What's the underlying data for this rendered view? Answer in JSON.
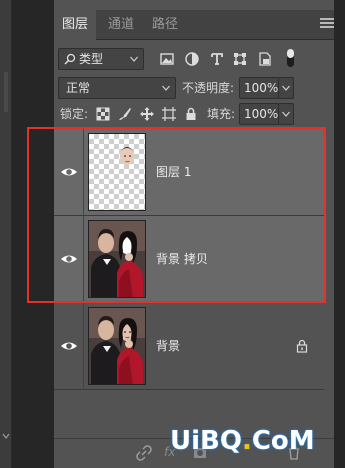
{
  "tabs": [
    {
      "label": "图层",
      "active": true
    },
    {
      "label": "通道",
      "active": false
    },
    {
      "label": "路径",
      "active": false
    }
  ],
  "filter": {
    "kind_label": "类型",
    "icons": [
      "image-filter-icon",
      "adjustment-filter-icon",
      "type-filter-icon",
      "shape-filter-icon",
      "smart-object-filter-icon"
    ]
  },
  "blend": {
    "mode": "正常",
    "opacity_label": "不透明度:",
    "opacity_value": "100%"
  },
  "lock": {
    "label": "锁定:",
    "fill_label": "填充:",
    "fill_value": "100%"
  },
  "layers": [
    {
      "name": "图层 1",
      "visible": true,
      "selected": true,
      "locked": false
    },
    {
      "name": "背景 拷贝",
      "visible": true,
      "selected": true,
      "locked": false
    },
    {
      "name": "背景",
      "visible": true,
      "selected": false,
      "locked": true
    }
  ],
  "bottombar": {
    "fx_label": "fx"
  },
  "watermark": {
    "text_a": "UiBQ",
    "text_dot": ".",
    "text_b": "CoM"
  },
  "colors": {
    "highlight_box": "#e5302b",
    "selected_row": "#696969",
    "panel_bg": "#535353"
  }
}
